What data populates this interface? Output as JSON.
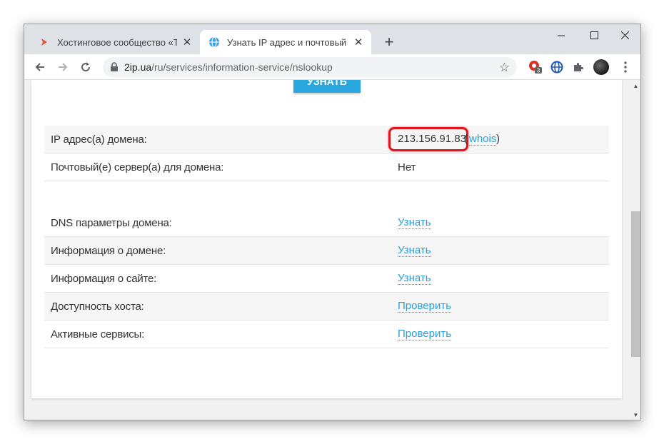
{
  "browser": {
    "tabs": [
      {
        "title": "Хостинговое сообщество «Time",
        "active": false,
        "favicon": "timeweb-chevron-icon"
      },
      {
        "title": "Узнать IP адрес и почтовый сер",
        "active": true,
        "favicon": "globe-icon"
      }
    ],
    "new_tab_label": "+",
    "url_host": "2ip.ua",
    "url_path": "/ru/services/information-service/nslookup",
    "extension_badge": "3"
  },
  "page": {
    "submit_label": "Узнать",
    "rows": [
      {
        "label": "IP адрес(а) домена:",
        "ip": "213.156.91.83",
        "whois_open": "(",
        "whois": "whois",
        "whois_close": ")"
      },
      {
        "label": "Почтовый(е) сервер(а) для домена:",
        "value": "Нет"
      },
      {
        "label": "DNS параметры домена:",
        "link": "Узнать"
      },
      {
        "label": "Информация о домене:",
        "link": "Узнать"
      },
      {
        "label": "Информация о сайте:",
        "link": "Узнать"
      },
      {
        "label": "Доступность хоста:",
        "link": "Проверить"
      },
      {
        "label": "Активные сервисы:",
        "link": "Проверить"
      }
    ]
  },
  "colors": {
    "accent": "#29a8e0",
    "link": "#2a9fd8",
    "highlight": "#e3121b"
  }
}
